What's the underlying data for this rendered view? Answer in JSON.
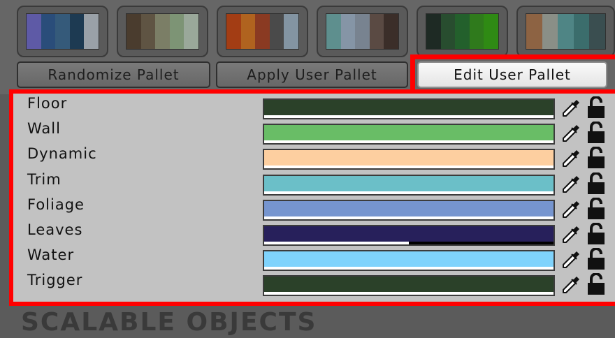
{
  "palette_presets": [
    {
      "colors": [
        "#5e5aa6",
        "#2a4d7a",
        "#355a7a",
        "#1d3a52",
        "#9aa1a8"
      ]
    },
    {
      "colors": [
        "#4a3c2e",
        "#5f5443",
        "#7b7e66",
        "#7d9475",
        "#9aa89a"
      ]
    },
    {
      "colors": [
        "#a33d14",
        "#b0631f",
        "#8a3a22",
        "#4a4a4a",
        "#8394a2"
      ]
    },
    {
      "colors": [
        "#5e8f8e",
        "#8595a6",
        "#788390",
        "#5a4a43",
        "#3b2e29"
      ]
    },
    {
      "colors": [
        "#1e2a24",
        "#284d2f",
        "#23602c",
        "#2f7a1c",
        "#2f8a14"
      ]
    },
    {
      "colors": [
        "#8d6343",
        "#8a8f87",
        "#4f8585",
        "#3b6d6c",
        "#3a4e50"
      ]
    }
  ],
  "buttons": {
    "randomize": "Randomize Pallet",
    "apply": "Apply User Pallet",
    "edit": "Edit User Pallet"
  },
  "palette_rows": [
    {
      "label": "Floor",
      "color": "#2b4129",
      "alpha": 1.0
    },
    {
      "label": "Wall",
      "color": "#69bd66",
      "alpha": 1.0
    },
    {
      "label": "Dynamic",
      "color": "#fdcfa0",
      "alpha": 1.0
    },
    {
      "label": "Trim",
      "color": "#6bbfc8",
      "alpha": 1.0
    },
    {
      "label": "Foliage",
      "color": "#7695cf",
      "alpha": 1.0
    },
    {
      "label": "Leaves",
      "color": "#27205b",
      "alpha": 0.5
    },
    {
      "label": "Water",
      "color": "#7fd3fc",
      "alpha": 1.0
    },
    {
      "label": "Trigger",
      "color": "#2b4129",
      "alpha": 1.0
    }
  ],
  "icons": {
    "picker": "eyedropper-icon",
    "lock": "unlocked-padlock-icon"
  },
  "footer": {
    "title": "SCALABLE OBJECTS"
  },
  "colors": {
    "highlight": "#ff0000",
    "panel_bg": "#c2c2c2",
    "toolbar_bg": "#666666"
  }
}
